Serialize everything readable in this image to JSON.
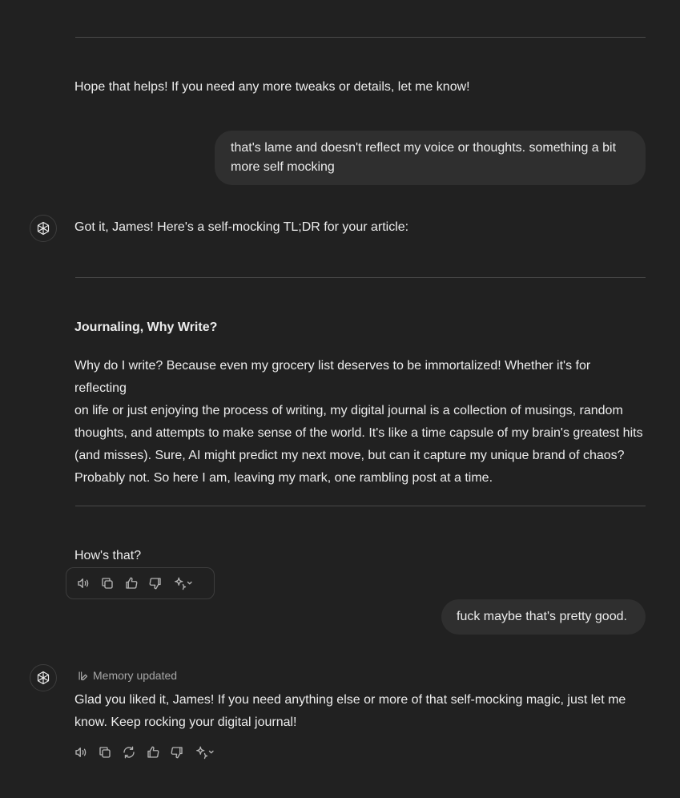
{
  "conversation": {
    "earlier_assistant": {
      "closing": "Hope that helps! If you need any more tweaks or details, let me know!"
    },
    "user_1": {
      "line1": "that's lame and doesn't reflect my voice or thoughts. something a bit",
      "line2": "more self mocking"
    },
    "assistant_1": {
      "intro": "Got it, James! Here's a self-mocking TL;DR for your article:",
      "heading": "Journaling, Why Write?",
      "paragraph_lines": [
        "Why do I write? Because even my grocery list deserves to be immortalized! Whether it's for reflecting",
        "on life or just enjoying the process of writing, my digital journal is a collection of musings, random",
        "thoughts, and attempts to make sense of the world. It's like a time capsule of my brain's greatest hits",
        "(and misses). Sure, AI might predict my next move, but can it capture my unique brand of chaos?",
        "Probably not. So here I am, leaving my mark, one rambling post at a time."
      ],
      "closing": "How's that?"
    },
    "user_2": {
      "text": "fuck maybe that's pretty good."
    },
    "assistant_2": {
      "memory_label": "Memory updated",
      "line1": "Glad you liked it, James! If you need anything else or more of that self-mocking magic, just let me",
      "line2": "know. Keep rocking your digital journal!"
    }
  },
  "icons": {
    "avatar": "openai-logo-icon",
    "read_aloud": "speaker-icon",
    "copy": "copy-icon",
    "regenerate": "refresh-icon",
    "thumbs_up": "thumbs-up-icon",
    "thumbs_down": "thumbs-down-icon",
    "model_switch": "sparkle-icon",
    "memory": "memory-pen-icon"
  },
  "colors": {
    "background": "#212121",
    "text": "#ececec",
    "muted": "#a6a6a6",
    "user_bubble": "#2f2f2f",
    "divider": "#4a4a4a"
  }
}
